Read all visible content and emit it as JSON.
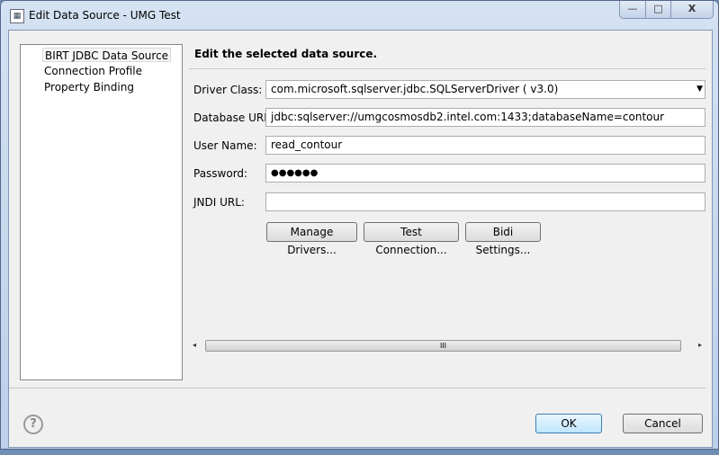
{
  "window": {
    "title": "Edit Data Source - UMG Test",
    "minimize": "—",
    "maximize": "□",
    "close": "X"
  },
  "tree": {
    "items": [
      {
        "label": "BIRT JDBC Data Source",
        "selected": true
      },
      {
        "label": "Connection Profile"
      },
      {
        "label": "Property Binding"
      }
    ]
  },
  "main": {
    "header": "Edit the selected data source.",
    "fields": {
      "driver_class": {
        "label": "Driver Class:",
        "value": "com.microsoft.sqlserver.jdbc.SQLServerDriver ( v3.0)"
      },
      "database_url": {
        "label": "Database URL:",
        "value": "jdbc:sqlserver://umgcosmosdb2.intel.com:1433;databaseName=contour"
      },
      "user_name": {
        "label": "User Name:",
        "value": "read_contour"
      },
      "password": {
        "label": "Password:",
        "value": "●●●●●●"
      },
      "jndi_url": {
        "label": "JNDI URL:",
        "value": ""
      }
    },
    "buttons": {
      "manage_drivers": "Manage Drivers...",
      "test_connection": "Test Connection...",
      "bidi_settings": "Bidi Settings..."
    },
    "scrollbar": {
      "grip": "III",
      "left": "◂",
      "right": "▸"
    }
  },
  "footer": {
    "help": "?",
    "ok": "OK",
    "cancel": "Cancel"
  }
}
